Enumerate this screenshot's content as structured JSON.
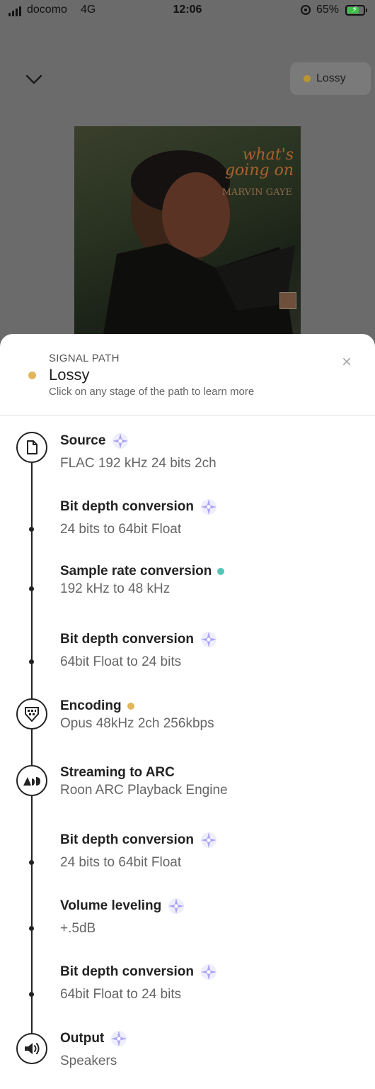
{
  "status_bar": {
    "carrier": "docomo",
    "network": "4G",
    "time": "12:06",
    "battery": "65%"
  },
  "player": {
    "quality_chip": "Lossy",
    "album": {
      "title": "what's\ngoing on",
      "artist": "MARVIN GAYE",
      "label": "TAMLA"
    }
  },
  "sheet": {
    "heading": "SIGNAL PATH",
    "title": "Lossy",
    "title_dot_color": "#e2b65b",
    "hint": "Click on any stage of the path to learn more",
    "close_icon": "close-icon"
  },
  "colors": {
    "sparkle": "#a9a3f5",
    "enhanced": "#55c4b8",
    "lossy": "#e2b65b"
  },
  "stages": [
    {
      "title": "Source",
      "detail": "FLAC 192 kHz 24 bits 2ch",
      "marker": "sparkle",
      "node": "file-icon"
    },
    {
      "title": "Bit depth conversion",
      "detail": "24 bits to 64bit Float",
      "marker": "sparkle",
      "node": "dot"
    },
    {
      "title": "Sample rate conversion",
      "detail": "192 kHz to 48 kHz",
      "marker": "teal-dot",
      "node": "dot"
    },
    {
      "title": "Bit depth conversion",
      "detail": "64bit Float to 24 bits",
      "marker": "sparkle",
      "node": "dot"
    },
    {
      "title": "Encoding",
      "detail": "Opus 48kHz 2ch 256kbps",
      "marker": "orange-dot",
      "node": "encoding-icon"
    },
    {
      "title": "Streaming to ARC",
      "detail": "Roon ARC Playback Engine",
      "marker": "none",
      "node": "arc-icon"
    },
    {
      "title": "Bit depth conversion",
      "detail": "24 bits to 64bit Float",
      "marker": "sparkle",
      "node": "dot"
    },
    {
      "title": "Volume leveling",
      "detail": "+.5dB",
      "marker": "sparkle",
      "node": "dot"
    },
    {
      "title": "Bit depth conversion",
      "detail": "64bit Float to 24 bits",
      "marker": "sparkle",
      "node": "dot"
    },
    {
      "title": "Output",
      "detail": "Speakers",
      "marker": "sparkle",
      "node": "speaker-icon"
    }
  ]
}
